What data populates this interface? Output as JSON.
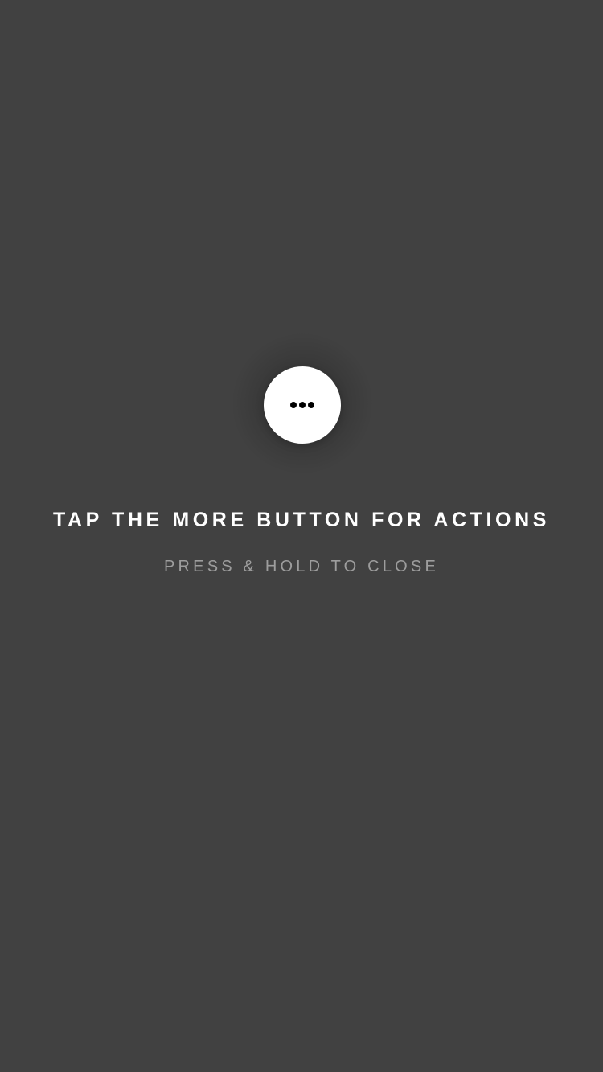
{
  "more_button": {
    "icon": "more-horizontal-icon"
  },
  "instructions": {
    "title": "TAP THE MORE BUTTON FOR ACTIONS",
    "subtitle": "PRESS & HOLD TO CLOSE"
  },
  "colors": {
    "background": "#414141",
    "button": "#ffffff",
    "title_text": "#ffffff",
    "subtitle_text": "#9d9d9d"
  }
}
